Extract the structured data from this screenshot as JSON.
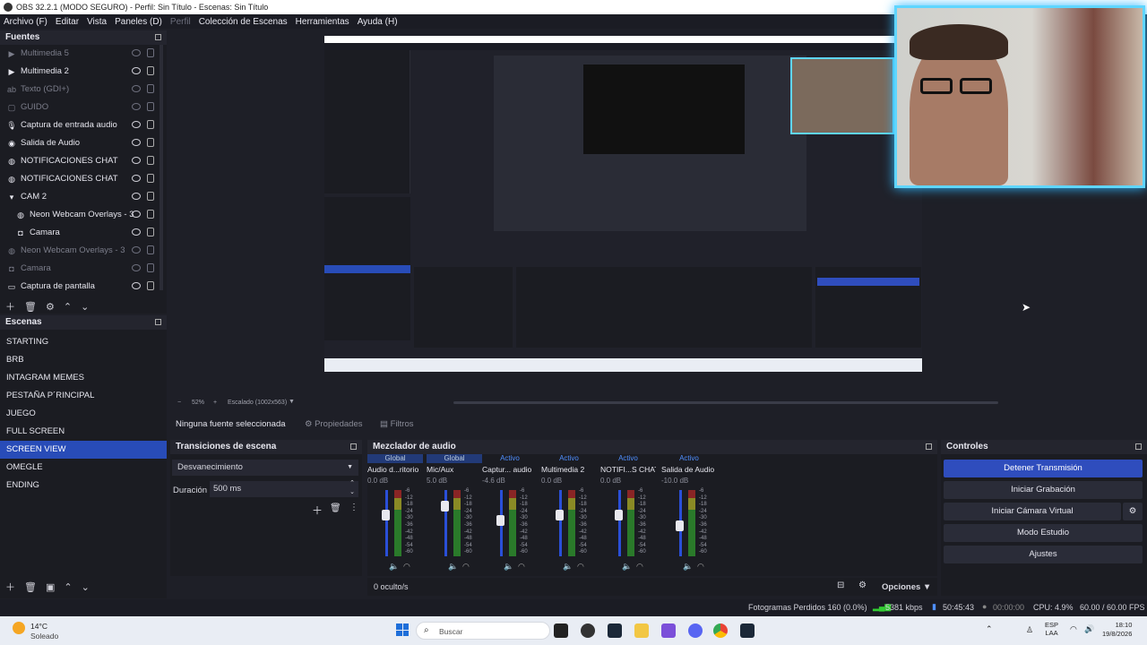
{
  "window": {
    "title": "OBS 32.2.1 (MODO SEGURO) - Perfil: Sin Título - Escenas: Sin Título"
  },
  "menu": [
    "Archivo (F)",
    "Editar",
    "Vista",
    "Paneles (D)",
    "Perfil",
    "Colección de Escenas",
    "Herramientas",
    "Ayuda (H)"
  ],
  "sources": {
    "title": "Fuentes",
    "items": [
      {
        "label": "Multimedia 5",
        "dim": true,
        "icon": "play-icon"
      },
      {
        "label": "Multimedia 2",
        "dim": false,
        "icon": "play-icon"
      },
      {
        "label": "Texto (GDI+)",
        "dim": true,
        "icon": "text-icon"
      },
      {
        "label": "GUIDO",
        "dim": true,
        "icon": "image-icon"
      },
      {
        "label": "Captura de entrada audio",
        "dim": false,
        "icon": "microphone-icon"
      },
      {
        "label": "Salida de Audio",
        "dim": false,
        "icon": "speaker-icon"
      },
      {
        "label": "NOTIFICACIONES CHAT",
        "dim": false,
        "icon": "browser-icon"
      },
      {
        "label": "NOTIFICACIONES CHAT",
        "dim": false,
        "icon": "browser-icon"
      },
      {
        "label": "CAM 2",
        "dim": false,
        "icon": "folder-icon"
      },
      {
        "label": "Neon Webcam Overlays - 3",
        "dim": false,
        "icon": "browser-icon"
      },
      {
        "label": "Camara",
        "dim": false,
        "icon": "camera-icon"
      },
      {
        "label": "Neon Webcam Overlays - 3",
        "dim": true,
        "icon": "browser-icon"
      },
      {
        "label": "Camara",
        "dim": true,
        "icon": "camera-icon"
      },
      {
        "label": "Captura de pantalla",
        "dim": false,
        "icon": "monitor-icon"
      }
    ]
  },
  "scenes": {
    "title": "Escenas",
    "items": [
      "STARTING",
      "BRB",
      "INTAGRAM MEMES",
      "PESTAÑA P´RINCIPAL",
      "JUEGO",
      "FULL SCREEN",
      "SCREEN VIEW",
      "OMEGLE",
      "ENDING"
    ],
    "active": "SCREEN VIEW"
  },
  "preview_bar": {
    "no_source": "Ninguna fuente seleccionada",
    "properties": "Propiedades",
    "filters": "Filtros",
    "zoom": "52%",
    "scaling": "Escalado (1002x563)"
  },
  "transitions": {
    "title": "Transiciones de escena",
    "transition": "Desvanecimiento",
    "duration_label": "Duración",
    "duration": "500 ms"
  },
  "mixer": {
    "title": "Mezclador de audio",
    "hidden": "0 oculto/s",
    "options": "Opciones",
    "channels": [
      {
        "status": "Global",
        "name": "Audio d...ritorio",
        "db": "0.0 dB",
        "level": 0.65
      },
      {
        "status": "Global",
        "name": "Mic/Aux",
        "db": "5.0 dB",
        "level": 0.8
      },
      {
        "status": "Activo",
        "name": "Captur... audio",
        "db": "-4.6 dB",
        "level": 0.55
      },
      {
        "status": "Activo",
        "name": "Multimedia 2",
        "db": "0.0 dB",
        "level": 0.65
      },
      {
        "status": "Activo",
        "name": "NOTIFI...S CHAT",
        "db": "0.0 dB",
        "level": 0.65
      },
      {
        "status": "Activo",
        "name": "Salida de Audio",
        "db": "-10.0 dB",
        "level": 0.45
      }
    ],
    "scale": [
      "-6",
      "-12",
      "-18",
      "-24",
      "-30",
      "-36",
      "-42",
      "-48",
      "-54",
      "-60"
    ]
  },
  "controls": {
    "title": "Controles",
    "stop_stream": "Detener Transmisión",
    "start_recording": "Iniciar Grabación",
    "virtual_camera": "Iniciar Cámara Virtual",
    "studio_mode": "Modo Estudio",
    "settings": "Ajustes"
  },
  "status": {
    "dropped": "Fotogramas Perdidos 160 (0.0%)",
    "bitrate": "5381 kbps",
    "stream_time": "50:45:43",
    "rec_time": "00:00:00",
    "cpu": "CPU: 4.9%",
    "fps": "60.00 / 60.00 FPS"
  },
  "taskbar": {
    "temp": "14°C",
    "weather": "Soleado",
    "search": "Buscar",
    "lang1": "ESP",
    "lang2": "LAA",
    "time": "18:10",
    "date": "19/8/2026"
  },
  "colors": {
    "accent": "#2f4dbd",
    "neon": "#5fd6ff"
  }
}
